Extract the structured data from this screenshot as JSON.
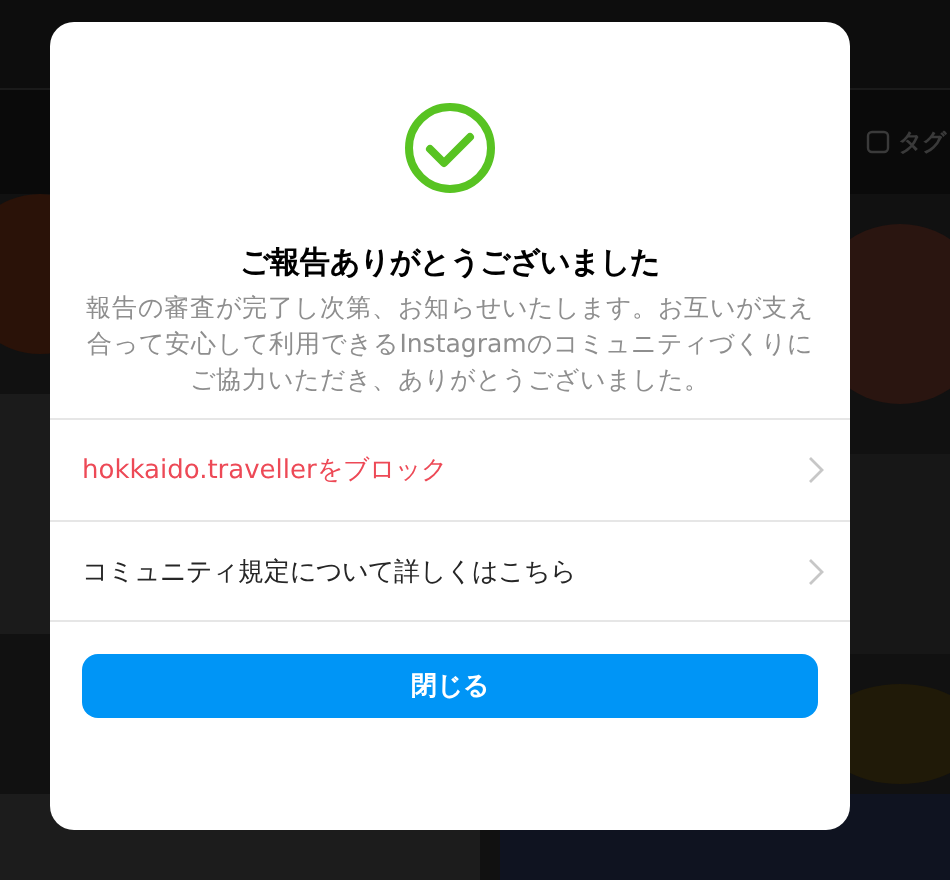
{
  "background": {
    "tab_label": "タグ"
  },
  "dialog": {
    "title": "ご報告ありがとうございました",
    "message": "報告の審査が完了し次第、お知らせいたします。お互いが支え合って安心して利用できるInstagramのコミュニティづくりにご協力いただき、ありがとうございました。",
    "actions": [
      {
        "label": "hokkaido.travellerをブロック",
        "kind": "danger"
      },
      {
        "label": "コミュニティ規定について詳しくはこちら",
        "kind": "link"
      }
    ],
    "close_button": "閉じる"
  }
}
